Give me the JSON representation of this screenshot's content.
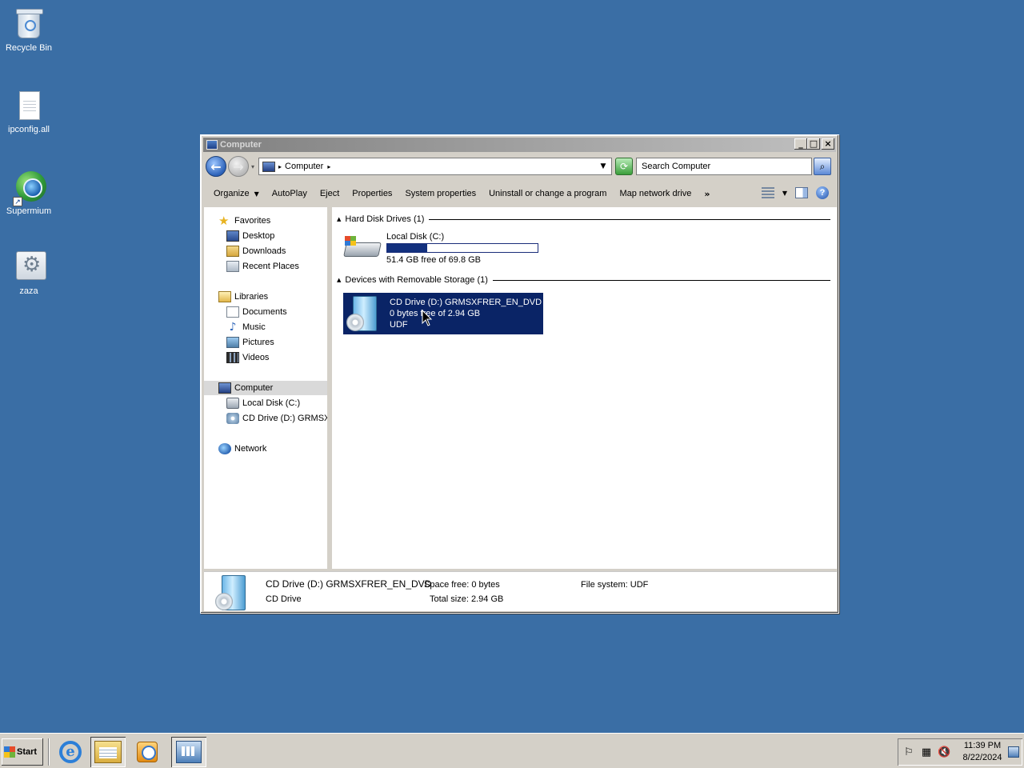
{
  "desktop": {
    "icons": [
      {
        "label": "Recycle Bin",
        "icon": "recycle-bin-icon"
      },
      {
        "label": "ipconfig.all",
        "icon": "text-file-icon"
      },
      {
        "label": "Supermium",
        "icon": "supermium-browser-icon"
      },
      {
        "label": "zaza",
        "icon": "settings-file-icon"
      }
    ]
  },
  "window": {
    "title": "Computer",
    "address": {
      "location": "Computer"
    },
    "search": {
      "placeholder": "Search Computer"
    },
    "toolbar": {
      "organize": "Organize",
      "autoplay": "AutoPlay",
      "eject": "Eject",
      "properties": "Properties",
      "system_properties": "System properties",
      "uninstall": "Uninstall or change a program",
      "map_drive": "Map network drive",
      "more": "»"
    },
    "nav": {
      "favorites": "Favorites",
      "desktop": "Desktop",
      "downloads": "Downloads",
      "recent": "Recent Places",
      "libraries": "Libraries",
      "documents": "Documents",
      "music": "Music",
      "pictures": "Pictures",
      "videos": "Videos",
      "computer": "Computer",
      "local_disk": "Local Disk (C:)",
      "cd_drive": "CD Drive (D:) GRMSXF",
      "network": "Network"
    },
    "content": {
      "groups": {
        "hdd": "Hard Disk Drives (1)",
        "removable": "Devices with Removable Storage (1)"
      },
      "local_disk": {
        "name": "Local Disk (C:)",
        "free_text": "51.4 GB free of 69.8 GB",
        "used_fraction": 0.264
      },
      "cd_drive": {
        "name": "CD Drive (D:) GRMSXFRER_EN_DVD",
        "free_text": "0 bytes free of 2.94 GB",
        "fs": "UDF"
      }
    },
    "details": {
      "name": "CD Drive (D:) GRMSXFRER_EN_DVD",
      "type": "CD Drive",
      "space_free_label": "Space free:",
      "space_free": "0 bytes",
      "total_size_label": "Total size:",
      "total_size": "2.94 GB",
      "fs_label": "File system:",
      "fs": "UDF"
    }
  },
  "taskbar": {
    "start": "Start",
    "time": "11:39 PM",
    "date": "8/22/2024",
    "pinned": [
      "internet-explorer-icon",
      "windows-explorer-icon",
      "media-player-icon",
      "server-manager-icon"
    ]
  },
  "colors": {
    "desktop": "#3a6ea5",
    "selection": "#0a2466",
    "usage_bar": "#13307e"
  }
}
